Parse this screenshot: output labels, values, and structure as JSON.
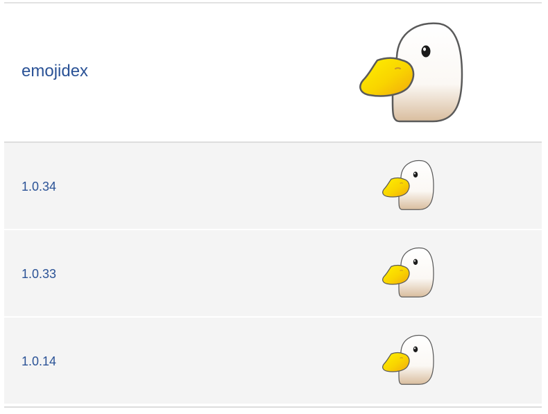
{
  "vendor": {
    "name": "emojidex",
    "icon": "duck-icon"
  },
  "versions": [
    {
      "label": "1.0.34",
      "icon": "duck-icon"
    },
    {
      "label": "1.0.33",
      "icon": "duck-icon"
    },
    {
      "label": "1.0.14",
      "icon": "duck-icon"
    }
  ],
  "colors": {
    "link": "#2a5296",
    "row_background": "#f4f4f4",
    "beak": "#f7d000",
    "duck_outline": "#5a5a5a"
  }
}
